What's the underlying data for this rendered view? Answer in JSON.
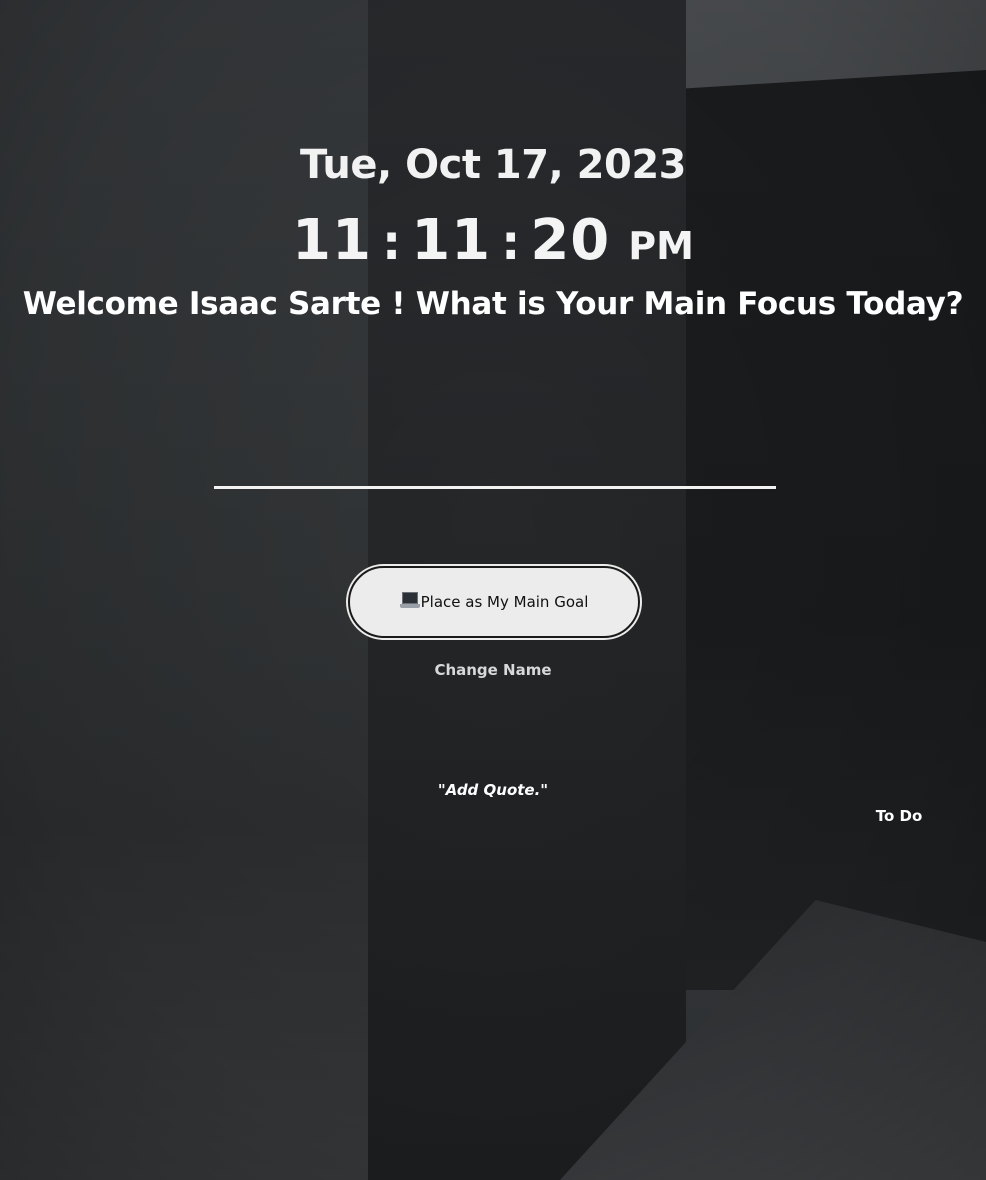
{
  "header": {
    "date": "Tue, Oct 17, 2023",
    "time": {
      "hours": "11",
      "minutes": "11",
      "seconds": "20",
      "separator": ":",
      "period": "PM"
    }
  },
  "greeting": {
    "text": "Welcome Isaac Sarte ! What is Your Main Focus Today?"
  },
  "focus_input": {
    "value": "",
    "placeholder": ""
  },
  "goal_button": {
    "icon": "laptop-icon",
    "label": "Place as My Main Goal"
  },
  "change_name": {
    "label": "Change Name"
  },
  "quote": {
    "text": "\"Add Quote.\""
  },
  "todo": {
    "label": "To Do"
  },
  "colors": {
    "text": "#ffffff",
    "button_bg": "#ececec",
    "button_border": "#1a1a1a",
    "background_dark": "#232527"
  }
}
